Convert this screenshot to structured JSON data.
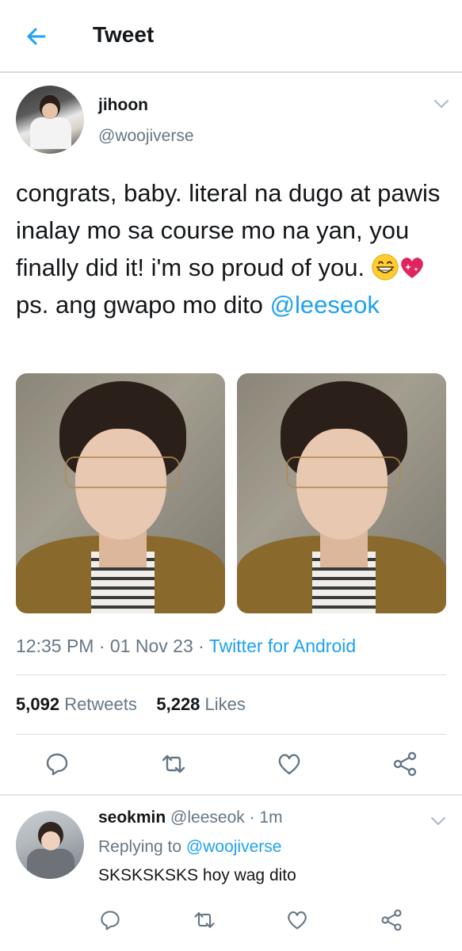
{
  "header": {
    "title": "Tweet",
    "back_icon": "arrow-left-icon"
  },
  "tweet": {
    "author_name": "jihoon",
    "author_handle": "@woojiverse",
    "text_before_emoji": "congrats, baby. literal na dugo at pawis inalay mo sa course mo na yan, you finally did it! i'm so proud of you.",
    "emojis": [
      "grinning-face-icon",
      "sparkling-heart-icon"
    ],
    "text_after_emoji": "ps. ang gwapo mo dito",
    "mention": "@leeseok",
    "time": "12:35 PM",
    "date": "01 Nov 23",
    "source": "Twitter for Android",
    "retweets_count": "5,092",
    "retweets_label": "Retweets",
    "likes_count": "5,228",
    "likes_label": "Likes"
  },
  "reply": {
    "author_name": "seokmin",
    "author_handle": "@leeseok",
    "time_ago": "1m",
    "replying_to_label": "Replying to",
    "replying_to_handle": "@woojiverse",
    "text": "SKSKSKSKS hoy wag dito"
  },
  "colors": {
    "accent": "#1da1f2",
    "secondary_text": "#657786",
    "primary_text": "#14171a",
    "divider": "#d9dde0"
  },
  "icons": {
    "actions": [
      "reply-icon",
      "retweet-icon",
      "like-heart-icon",
      "share-icon"
    ]
  }
}
